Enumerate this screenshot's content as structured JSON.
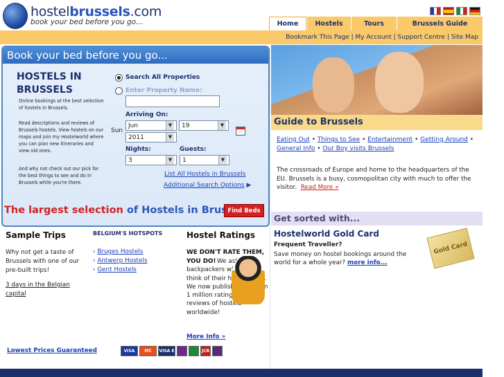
{
  "header": {
    "logo_prefix": "hostel",
    "logo_bold": "brussels",
    "logo_suffix": ".com",
    "tagline": "book your bed before you go...",
    "flags": [
      {
        "name": "french",
        "colors": [
          "#1f3f9e",
          "#ffffff",
          "#d32020"
        ]
      },
      {
        "name": "spanish",
        "colors": [
          "#c8102e",
          "#f6c400",
          "#c8102e"
        ]
      },
      {
        "name": "italian",
        "colors": [
          "#1a8a3a",
          "#ffffff",
          "#d32020"
        ]
      },
      {
        "name": "german",
        "colors": [
          "#111111",
          "#d32020",
          "#f6c400"
        ]
      }
    ]
  },
  "nav": {
    "tabs": [
      {
        "label": "Home",
        "active": true
      },
      {
        "label": "Hostels",
        "active": false
      },
      {
        "label": "Tours",
        "active": false
      },
      {
        "label": "Brussels Guide",
        "active": false
      }
    ],
    "sub_links": [
      "Bookmark This Page",
      "My Account",
      "Support Centre",
      "Site Map"
    ]
  },
  "search": {
    "panel_title": "Book your bed before you go...",
    "heading_line1": "HOSTELS IN",
    "heading_line2": "BRUSSELS",
    "intro1": "Online bookings at the best selection of hostels in Brussels.",
    "intro2": "Read descriptions and reviews of Brussels hostels. View hostels on our maps and join my Hostelworld where you can plan new itineraries and view old ones.",
    "intro3": "And why not check out our pick for the best things to see and do in Brussels while you're there.",
    "radio_all": "Search All Properties",
    "radio_name": "Enter Property Name:",
    "arriving_label": "Arriving On:",
    "day_name": "Sun",
    "month": "Jun",
    "day": "19",
    "year": "2011",
    "nights_label": "Nights:",
    "nights": "3",
    "guests_label": "Guests:",
    "guests": "1",
    "list_all": "List All Hostels in Brussels",
    "additional": "Additional Search Options",
    "largest_red": "The largest selection",
    "largest_blue": " of Hostels in Brussels",
    "find_button": "Find Beds"
  },
  "sample_trips": {
    "heading": "Sample Trips",
    "text": "Why not get a taste of Brussels with one of our pre-built trips!",
    "link": "3 days in the Belgian capital"
  },
  "hotspots": {
    "heading": "BELGIUM'S HOTSPOTS",
    "links": [
      "Bruges Hostels",
      "Antwerp Hostels",
      "Gent Hostels"
    ]
  },
  "ratings": {
    "heading": "Hostel Ratings",
    "bold": "WE DON'T RATE THEM, YOU DO!",
    "text": "We ask other backpackers what they think of their hostel stays. We now publish more than 1 million ratings and reviews of hostels worldwide!",
    "more": "More Info »"
  },
  "footer": {
    "lowest": "Lowest Prices Guaranteed",
    "cards": [
      {
        "label": "VISA",
        "color": "#1a3a9a"
      },
      {
        "label": "MC",
        "color": "#e8501a"
      },
      {
        "label": "VISA E",
        "color": "#1c2f6b"
      },
      {
        "label": "",
        "color": "#6a2a8a"
      },
      {
        "label": "",
        "color": "#1a8a3a"
      },
      {
        "label": "JCB",
        "color": "#c02020"
      },
      {
        "label": "",
        "color": "#5a2a7a"
      }
    ]
  },
  "guide": {
    "heading": "Guide to Brussels",
    "links": [
      "Eating Out",
      "Things to See",
      "Entertainment",
      "Getting Around",
      "General Info",
      "Our Boy visits Brussels"
    ],
    "desc": "The crossroads of Europe and home to the headquarters of the EU. Brussels is a busy, cosmopolitan city with much to offer the visitor.",
    "read_more": "Read More »"
  },
  "sorted": {
    "heading": "Get sorted with...",
    "gc_title": "Hostelworld Gold Card",
    "gc_sub": "Frequent Traveller?",
    "gc_desc": "Save money on hostel bookings around the world for a whole year?",
    "gc_more": "more info...",
    "card_label": "Gold Card"
  }
}
